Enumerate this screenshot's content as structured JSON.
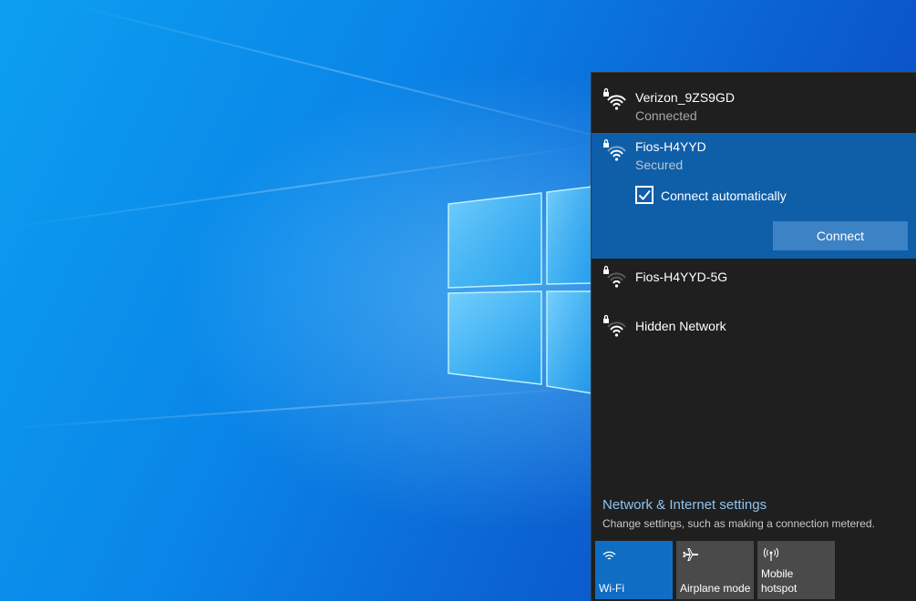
{
  "networks": [
    {
      "name": "Verizon_9ZS9GD",
      "status": "Connected",
      "icon": "wifi-secured-icon",
      "state": "connected"
    },
    {
      "name": "Fios-H4YYD",
      "status": "Secured",
      "icon": "wifi-secured-icon",
      "state": "selected",
      "auto_connect_label": "Connect automatically",
      "auto_connect_checked": true,
      "connect_label": "Connect"
    },
    {
      "name": "Fios-H4YYD-5G",
      "status": "",
      "icon": "wifi-secured-icon",
      "state": "available"
    },
    {
      "name": "Hidden Network",
      "status": "",
      "icon": "wifi-secured-icon",
      "state": "available"
    }
  ],
  "settings": {
    "link": "Network & Internet settings",
    "description": "Change settings, such as making a connection metered."
  },
  "quick_actions": [
    {
      "label": "Wi-Fi",
      "icon": "wifi-icon",
      "active": true
    },
    {
      "label": "Airplane mode",
      "icon": "airplane-icon",
      "active": false
    },
    {
      "label": "Mobile hotspot",
      "icon": "hotspot-icon",
      "active": false
    }
  ],
  "colors": {
    "panel": "#1f1f1f",
    "selected": "#0f5ea8",
    "accent_button": "#3d82c4",
    "link": "#8fc3f2",
    "tile_active": "#0f6ec4",
    "tile_inactive": "#4a4a4a"
  }
}
